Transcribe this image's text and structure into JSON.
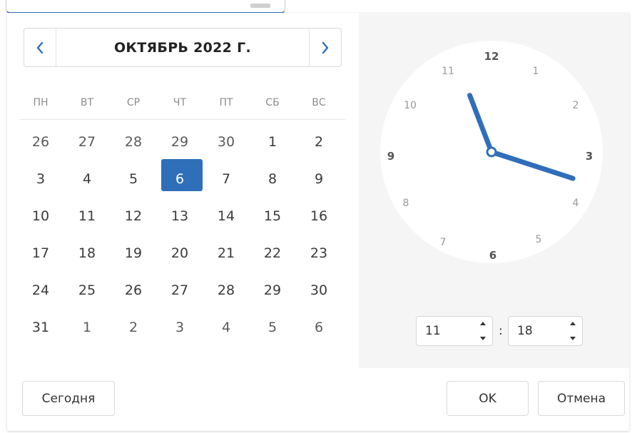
{
  "calendar": {
    "month_title": "ОКТЯБРЬ 2022 Г.",
    "prev_icon": "chevron-left-icon",
    "next_icon": "chevron-right-icon",
    "accent_color": "#2f6fba",
    "weekdays": [
      "ПН",
      "ВТ",
      "СР",
      "ЧТ",
      "ПТ",
      "СБ",
      "ВС"
    ],
    "weeks": [
      [
        "26",
        "27",
        "28",
        "29",
        "30",
        "1",
        "2"
      ],
      [
        "3",
        "4",
        "5",
        "6",
        "7",
        "8",
        "9"
      ],
      [
        "10",
        "11",
        "12",
        "13",
        "14",
        "15",
        "16"
      ],
      [
        "17",
        "18",
        "19",
        "20",
        "21",
        "22",
        "23"
      ],
      [
        "24",
        "25",
        "26",
        "27",
        "28",
        "29",
        "30"
      ],
      [
        "31",
        "1",
        "2",
        "3",
        "4",
        "5",
        "6"
      ]
    ],
    "selected_day": "6"
  },
  "clock": {
    "numbers": [
      "12",
      "1",
      "2",
      "3",
      "4",
      "5",
      "6",
      "7",
      "8",
      "9",
      "10",
      "11"
    ],
    "hour": 11,
    "minute": 18,
    "hand_color": "#2f6fba",
    "hour_value": "11",
    "minute_value": "18",
    "separator": ":"
  },
  "footer": {
    "today_label": "Сегодня",
    "ok_label": "OK",
    "cancel_label": "Отмена"
  }
}
